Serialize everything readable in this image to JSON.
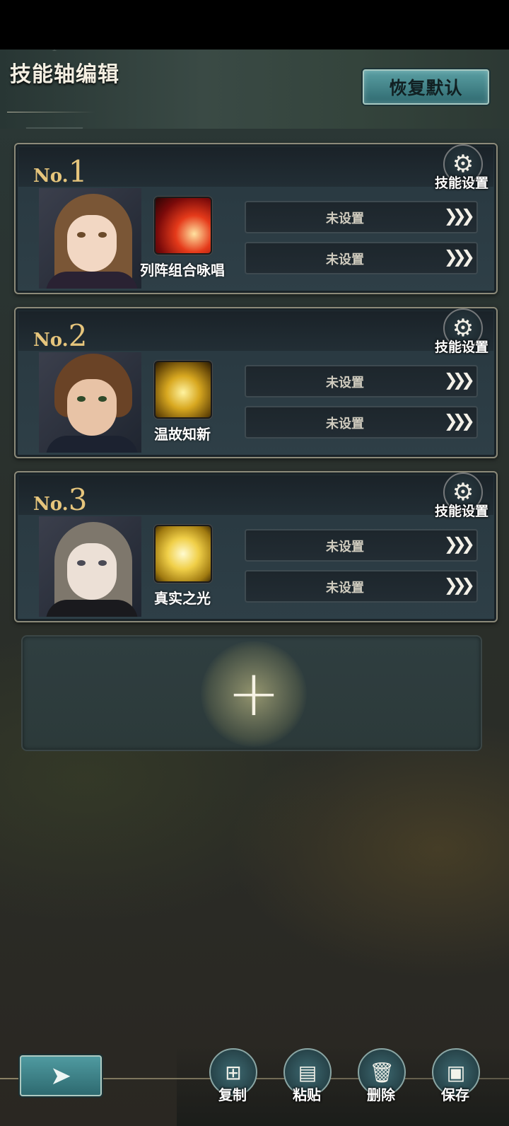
{
  "header": {
    "title": "技能轴编辑",
    "restore_label": "恢复默认"
  },
  "cards": [
    {
      "no_prefix": "No.",
      "no_num": "1",
      "gear_label": "技能设置",
      "skill_name": "列阵组合咏唱",
      "slots": [
        "未设置",
        "未设置"
      ],
      "skill_icon": "red-beam-icon",
      "colors": {
        "hair": "#7a5636",
        "eye": "#6b4a2a",
        "body": "#2a2233",
        "icon": "#c21818"
      }
    },
    {
      "no_prefix": "No.",
      "no_num": "2",
      "gear_label": "技能设置",
      "skill_name": "温故知新",
      "slots": [
        "未设置",
        "未设置"
      ],
      "skill_icon": "golden-warrior-icon",
      "colors": {
        "hair": "#6a4326",
        "eye": "#2f4a2a",
        "body": "#1c2230",
        "icon": "#c89a18"
      }
    },
    {
      "no_prefix": "No.",
      "no_num": "3",
      "gear_label": "技能设置",
      "skill_name": "真实之光",
      "slots": [
        "未设置",
        "未设置"
      ],
      "skill_icon": "golden-light-icon",
      "colors": {
        "hair": "#7e776c",
        "eye": "#4a4a55",
        "body": "#1a1a1e",
        "icon": "#e6c23a"
      }
    }
  ],
  "add_card": {
    "icon": "plus-icon"
  },
  "toolbar": {
    "back_icon": "back-arrow-icon",
    "copy_label": "复制",
    "paste_label": "粘贴",
    "delete_label": "删除",
    "save_label": "保存"
  }
}
